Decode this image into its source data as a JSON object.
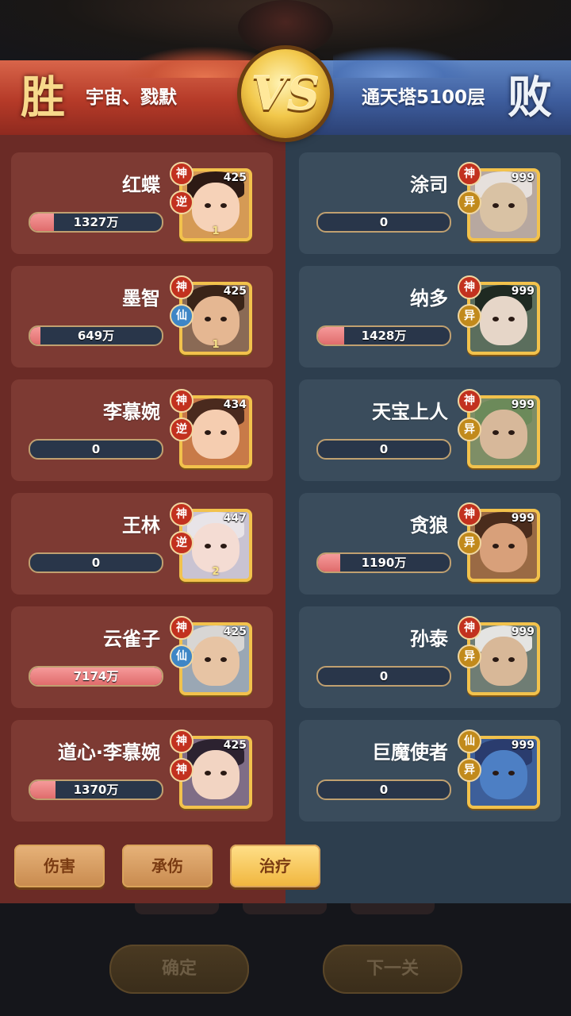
{
  "header": {
    "win_char": "胜",
    "lose_char": "败",
    "left_team": "宇宙、戮默",
    "right_team": "通天塔5100层",
    "vs": "VS"
  },
  "colors": {
    "win_panel": "#6b2b26",
    "lose_panel": "#2d3e4e",
    "bar_fill": "#e06c6c",
    "frame_gold": "#f2c24c"
  },
  "left_heroes": [
    {
      "name": "红蝶",
      "value": "1327万",
      "fill": 0.18,
      "level": "425",
      "badge_top": "神",
      "badge_bottom": "逆",
      "stars": "1"
    },
    {
      "name": "墨智",
      "value": "649万",
      "fill": 0.08,
      "level": "425",
      "badge_top": "神",
      "badge_bottom": "仙",
      "stars": "1"
    },
    {
      "name": "李慕婉",
      "value": "0",
      "fill": 0,
      "level": "434",
      "badge_top": "神",
      "badge_bottom": "逆",
      "stars": ""
    },
    {
      "name": "王林",
      "value": "0",
      "fill": 0,
      "level": "447",
      "badge_top": "神",
      "badge_bottom": "逆",
      "stars": "2"
    },
    {
      "name": "云雀子",
      "value": "7174万",
      "fill": 1.0,
      "level": "425",
      "badge_top": "神",
      "badge_bottom": "仙",
      "stars": ""
    },
    {
      "name": "道心·李慕婉",
      "value": "1370万",
      "fill": 0.19,
      "level": "425",
      "badge_top": "神",
      "badge_bottom": "神",
      "stars": ""
    }
  ],
  "right_heroes": [
    {
      "name": "涂司",
      "value": "0",
      "fill": 0,
      "level": "999",
      "badge_top": "神",
      "badge_bottom": "异",
      "stars": ""
    },
    {
      "name": "纳多",
      "value": "1428万",
      "fill": 0.2,
      "level": "999",
      "badge_top": "神",
      "badge_bottom": "异",
      "stars": ""
    },
    {
      "name": "天宝上人",
      "value": "0",
      "fill": 0,
      "level": "999",
      "badge_top": "神",
      "badge_bottom": "异",
      "stars": ""
    },
    {
      "name": "贪狼",
      "value": "1190万",
      "fill": 0.17,
      "level": "999",
      "badge_top": "神",
      "badge_bottom": "异",
      "stars": ""
    },
    {
      "name": "孙泰",
      "value": "0",
      "fill": 0,
      "level": "999",
      "badge_top": "神",
      "badge_bottom": "异",
      "stars": ""
    },
    {
      "name": "巨魔使者",
      "value": "0",
      "fill": 0,
      "level": "999",
      "badge_top": "仙",
      "badge_bottom": "异",
      "stars": ""
    }
  ],
  "tabs": [
    {
      "label": "伤害",
      "selected": false
    },
    {
      "label": "承伤",
      "selected": false
    },
    {
      "label": "治疗",
      "selected": true
    }
  ],
  "footer": {
    "confirm": "确定",
    "next": "下一关"
  }
}
